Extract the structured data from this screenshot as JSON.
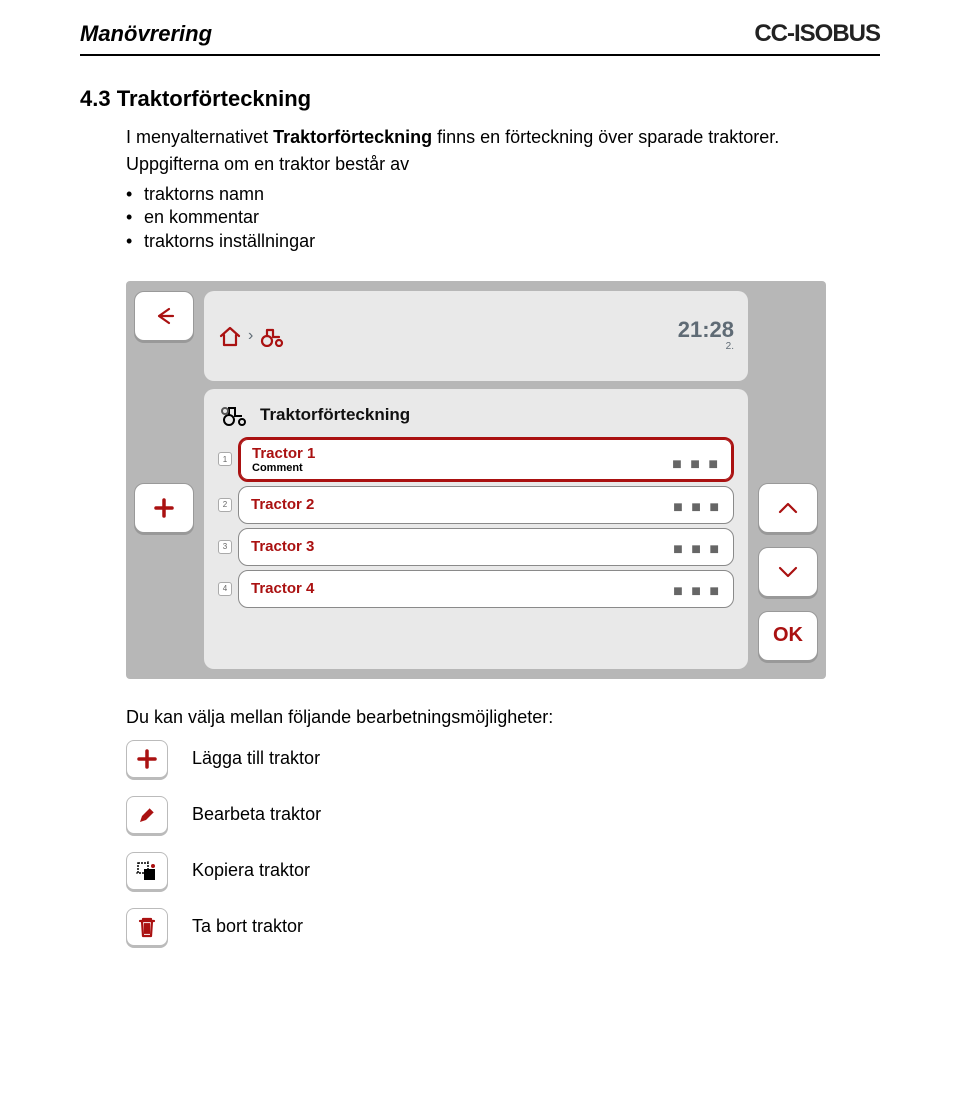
{
  "header": {
    "doc_title": "Manövrering",
    "brand": "CC-ISOBUS"
  },
  "section": {
    "number": "4.3",
    "title": "Traktorförteckning",
    "intro_pre": "I menyalternativet ",
    "intro_bold": "Traktorförteckning",
    "intro_post": " finns en förteckning över sparade traktorer.",
    "intro2": "Uppgifterna om en traktor består av",
    "bullets": [
      "traktorns namn",
      "en kommentar",
      "traktorns inställningar"
    ]
  },
  "device": {
    "clock": "21:28",
    "clock_sub": "2.",
    "panel_title": "Traktorförteckning",
    "rows": [
      {
        "n": "1",
        "title": "Tractor 1",
        "sub": "Comment",
        "selected": true
      },
      {
        "n": "2",
        "title": "Tractor 2",
        "sub": "",
        "selected": false
      },
      {
        "n": "3",
        "title": "Tractor 3",
        "sub": "",
        "selected": false
      },
      {
        "n": "4",
        "title": "Tractor 4",
        "sub": "",
        "selected": false
      }
    ],
    "ok_label": "OK"
  },
  "options": {
    "intro": "Du kan välja mellan följande bearbetningsmöjligheter:",
    "items": [
      {
        "icon": "plus",
        "label": "Lägga till traktor"
      },
      {
        "icon": "pencil",
        "label": "Bearbeta traktor"
      },
      {
        "icon": "copy",
        "label": "Kopiera traktor"
      },
      {
        "icon": "trash",
        "label": "Ta bort traktor"
      }
    ]
  }
}
